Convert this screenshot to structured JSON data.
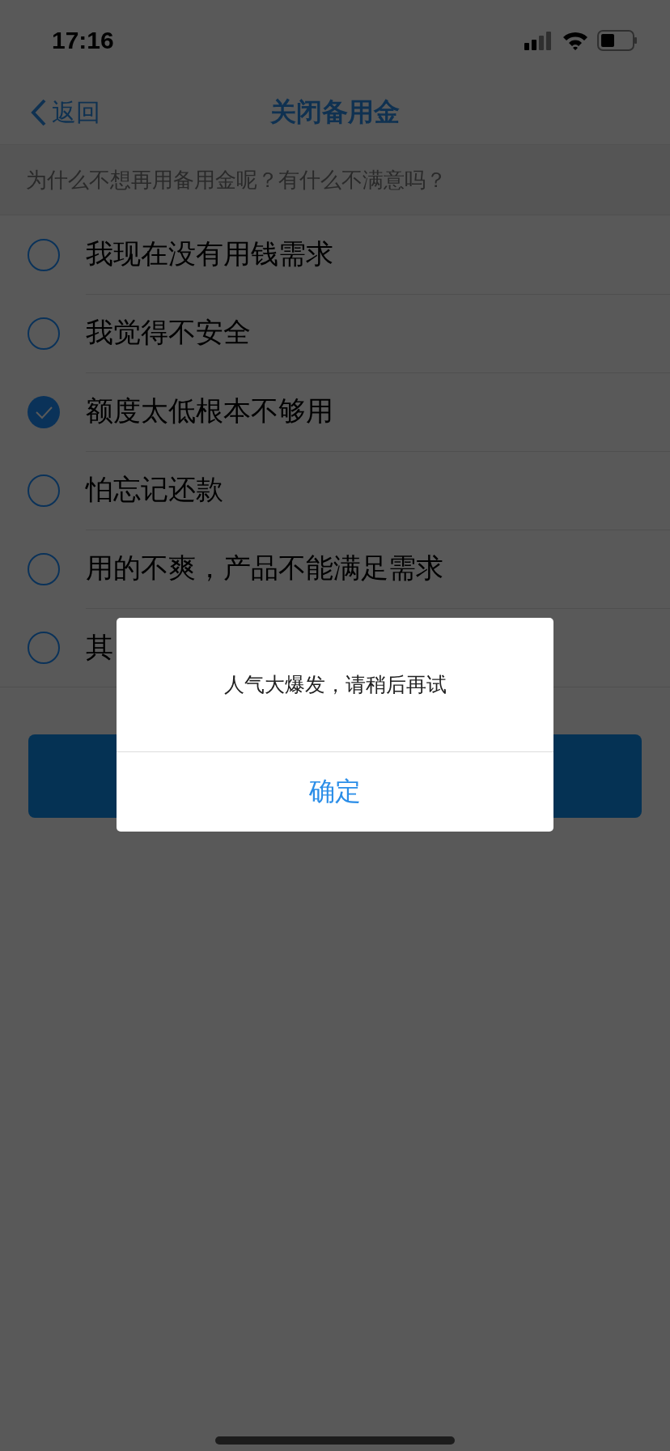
{
  "status_bar": {
    "time": "17:16"
  },
  "nav": {
    "back": "返回",
    "title": "关闭备用金"
  },
  "question": "为什么不想再用备用金呢？有什么不满意吗？",
  "options": [
    {
      "label": "我现在没有用钱需求",
      "selected": false
    },
    {
      "label": "我觉得不安全",
      "selected": false
    },
    {
      "label": "额度太低根本不够用",
      "selected": true
    },
    {
      "label": "怕忘记还款",
      "selected": false
    },
    {
      "label": "用的不爽，产品不能满足需求",
      "selected": false
    },
    {
      "label": "其",
      "selected": false
    }
  ],
  "dialog": {
    "message": "人气大爆发，请稍后再试",
    "button": "确定"
  }
}
